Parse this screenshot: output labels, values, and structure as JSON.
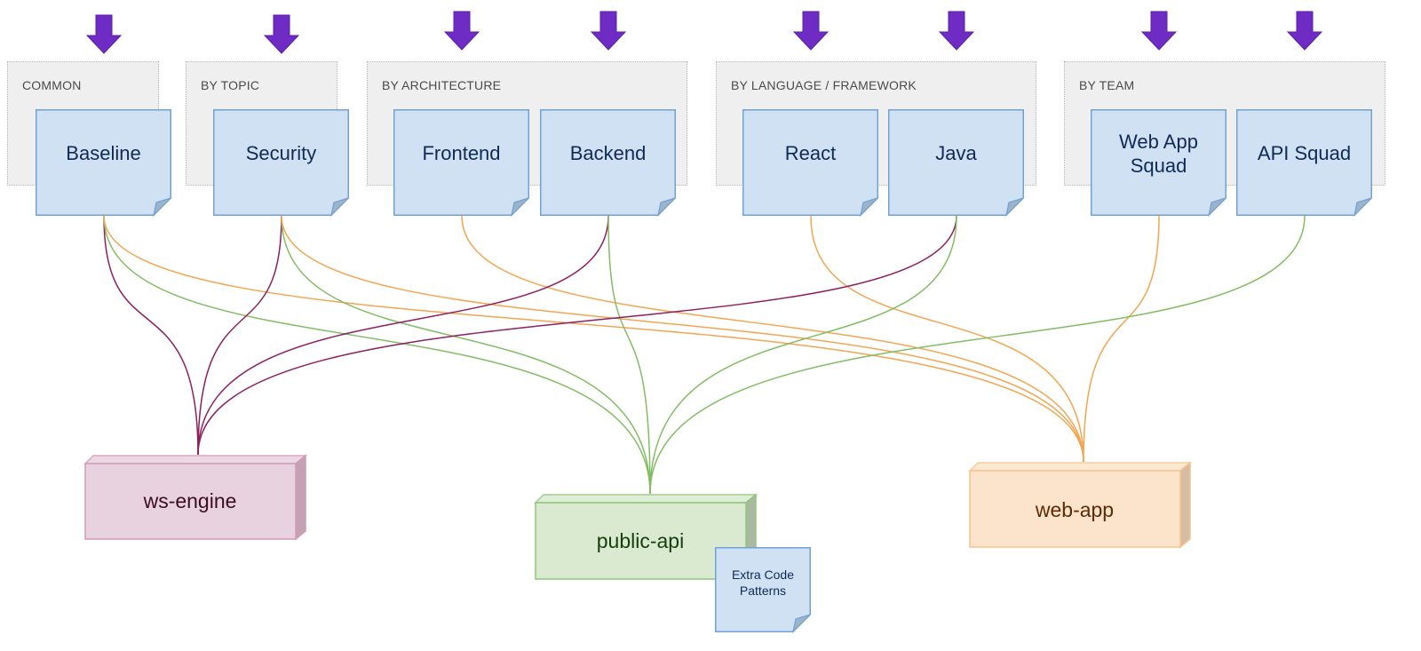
{
  "diagram": {
    "groups": [
      {
        "id": "common",
        "label": "COMMON"
      },
      {
        "id": "by-topic",
        "label": "BY TOPIC"
      },
      {
        "id": "by-architecture",
        "label": "BY ARCHITECTURE"
      },
      {
        "id": "by-language",
        "label": "BY LANGUAGE / FRAMEWORK"
      },
      {
        "id": "by-team",
        "label": "BY TEAM"
      }
    ],
    "rule_notes": [
      {
        "id": "baseline",
        "label": "Baseline",
        "group": "common"
      },
      {
        "id": "security",
        "label": "Security",
        "group": "by-topic"
      },
      {
        "id": "frontend",
        "label": "Frontend",
        "group": "by-architecture"
      },
      {
        "id": "backend",
        "label": "Backend",
        "group": "by-architecture"
      },
      {
        "id": "react",
        "label": "React",
        "group": "by-language"
      },
      {
        "id": "java",
        "label": "Java",
        "group": "by-language"
      },
      {
        "id": "web-app-squad",
        "label": "Web App\nSquad",
        "group": "by-team"
      },
      {
        "id": "api-squad",
        "label": "API Squad",
        "group": "by-team"
      }
    ],
    "projects": [
      {
        "id": "ws-engine",
        "label": "ws-engine",
        "color": "purple"
      },
      {
        "id": "public-api",
        "label": "public-api",
        "color": "green"
      },
      {
        "id": "web-app",
        "label": "web-app",
        "color": "orange"
      }
    ],
    "extra_note": {
      "id": "extra-code-patterns",
      "label": "Extra Code\nPatterns",
      "attached_to": "public-api"
    },
    "connections": [
      {
        "from": "baseline",
        "to": "ws-engine"
      },
      {
        "from": "baseline",
        "to": "public-api"
      },
      {
        "from": "baseline",
        "to": "web-app"
      },
      {
        "from": "security",
        "to": "ws-engine"
      },
      {
        "from": "security",
        "to": "public-api"
      },
      {
        "from": "security",
        "to": "web-app"
      },
      {
        "from": "frontend",
        "to": "web-app"
      },
      {
        "from": "backend",
        "to": "ws-engine"
      },
      {
        "from": "backend",
        "to": "public-api"
      },
      {
        "from": "react",
        "to": "web-app"
      },
      {
        "from": "java",
        "to": "ws-engine"
      },
      {
        "from": "java",
        "to": "public-api"
      },
      {
        "from": "web-app-squad",
        "to": "web-app"
      },
      {
        "from": "api-squad",
        "to": "public-api"
      }
    ],
    "colors": {
      "arrow": "#6e2cc4",
      "note_fill": "#cfe1f3",
      "note_stroke": "#6fa3d8",
      "purple_line": "#8e1f5e",
      "green_line": "#82bd64",
      "orange_line": "#f3a552",
      "purple_fill": "#e9d2df",
      "purple_stroke": "#d39ab8",
      "purple_text": "#3b0d24",
      "green_fill": "#d9ead0",
      "green_stroke": "#92c57c",
      "green_text": "#173d0c",
      "orange_fill": "#fbe4cb",
      "orange_stroke": "#f5c48e",
      "orange_text": "#5e2a06"
    }
  }
}
